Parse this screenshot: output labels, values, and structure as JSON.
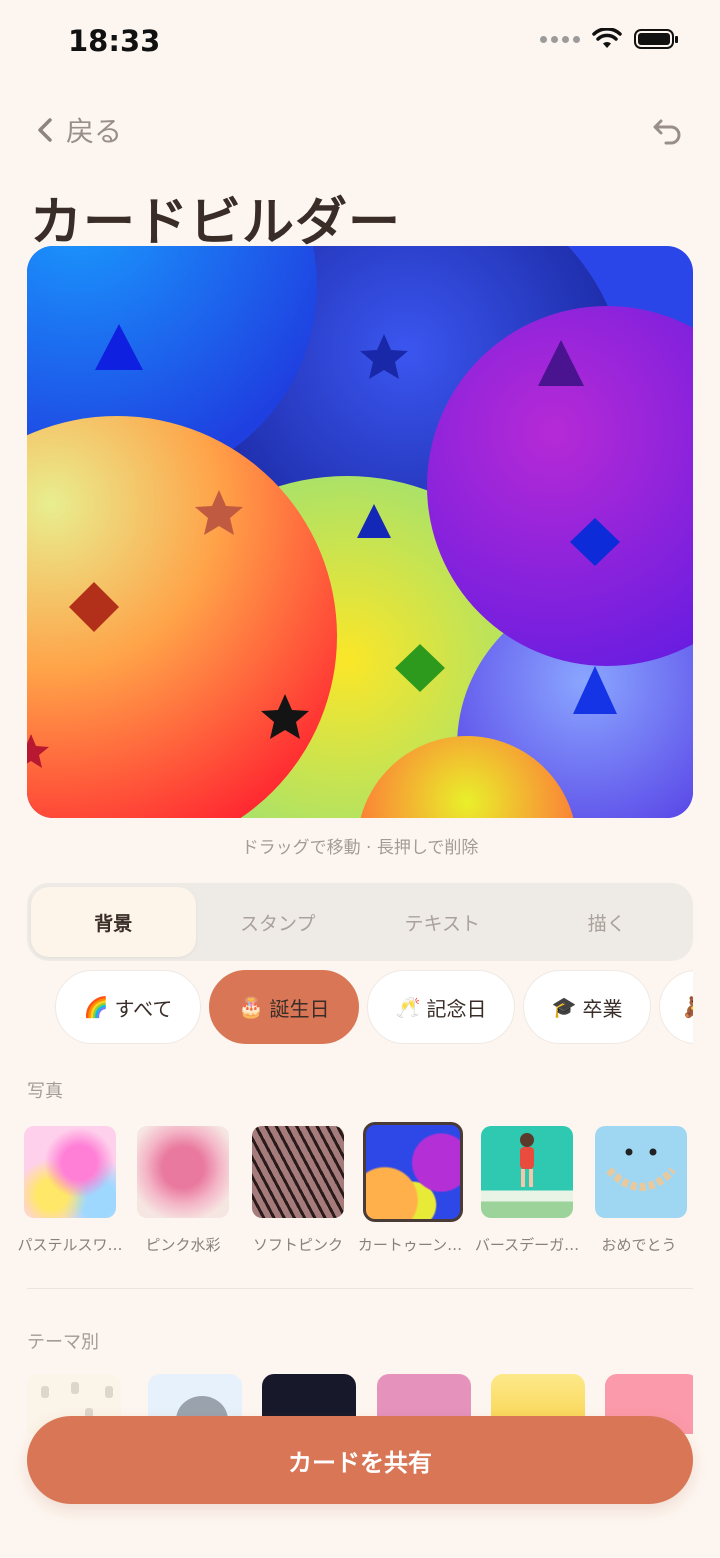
{
  "status": {
    "time": "18:33"
  },
  "nav": {
    "back_label": "戻る"
  },
  "title": "カードビルダー",
  "canvas_hint": "ドラッグで移動 · 長押しで削除",
  "tabs": [
    {
      "label": "背景",
      "active": true
    },
    {
      "label": "スタンプ",
      "active": false
    },
    {
      "label": "テキスト",
      "active": false
    },
    {
      "label": "描く",
      "active": false
    }
  ],
  "categories": [
    {
      "emoji": "🌈",
      "label": "すべて",
      "active": false
    },
    {
      "emoji": "🎂",
      "label": "誕生日",
      "active": true
    },
    {
      "emoji": "🥂",
      "label": "記念日",
      "active": false
    },
    {
      "emoji": "🎓",
      "label": "卒業",
      "active": false
    },
    {
      "emoji": "🧸",
      "label": "",
      "active": false
    }
  ],
  "photos_section": {
    "label": "写真",
    "items": [
      {
        "caption": "パステルスワ…",
        "selected": false
      },
      {
        "caption": "ピンク水彩",
        "selected": false
      },
      {
        "caption": "ソフトピンク",
        "selected": false
      },
      {
        "caption": "カートゥーン…",
        "selected": true
      },
      {
        "caption": "バースデーガ…",
        "selected": false
      },
      {
        "caption": "おめでとう",
        "selected": false
      }
    ]
  },
  "themes_section": {
    "label": "テーマ別"
  },
  "share_button": "カードを共有",
  "colors": {
    "accent": "#d97656",
    "background": "#fdf6f0"
  }
}
